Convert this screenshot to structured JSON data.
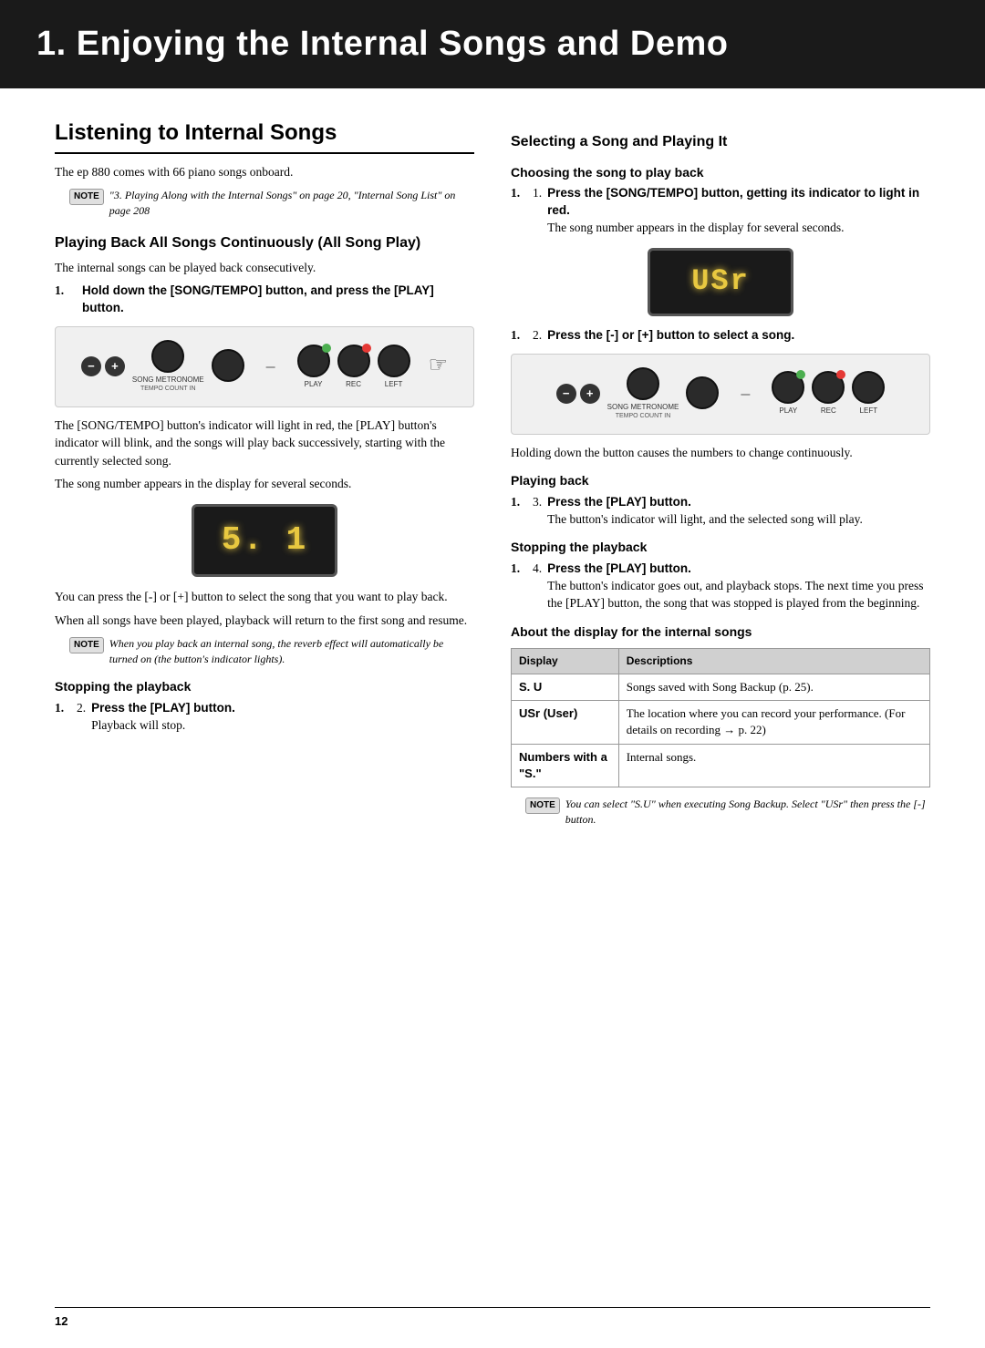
{
  "chapter": {
    "title": "1. Enjoying the Internal Songs and Demo"
  },
  "notes": {
    "label": "NOTE"
  },
  "sections": {
    "listening": {
      "title": "Listening to Internal Songs",
      "intro": "The ep 880 comes with 66 piano songs onboard.",
      "note": "\"3. Playing Along with the Internal Songs\" on page 20, \"Internal Song List\" on page 208"
    },
    "allSongPlay": {
      "title": "Playing Back All Songs Continuously (All Song Play)",
      "intro": "The internal songs can be played back consecutively.",
      "step1": "Hold down the [SONG/TEMPO] button, and press the [PLAY] button.",
      "desc1": "The [SONG/TEMPO] button's indicator will light in red, the [PLAY] button's indicator will blink, and the songs will play back successively, starting with the currently selected song.",
      "desc2": "The song number appears in the display for several seconds.",
      "selectSong": "You can press the [-] or [+] button to select the song that you want to play back.",
      "allSongsPlayed": "When all songs have been played, playback will return to the first song and resume.",
      "note": "When you play back an internal song, the reverb effect will automatically be turned on (the button's indicator lights)."
    },
    "stoppingLeft": {
      "title": "Stopping the playback",
      "step2": "Press the [PLAY] button.",
      "step2desc": "Playback will stop."
    },
    "selectingSong": {
      "title": "Selecting a Song and Playing It",
      "subtitle": "Choosing the song to play back",
      "step1": "Press the [SONG/TEMPO] button, getting its indicator to light in red.",
      "step1desc": "The song number appears in the display for several seconds.",
      "step2": "Press the [-] or [+] button to select a song.",
      "holdingDesc": "Holding down the button causes the numbers to change continuously."
    },
    "playingBack": {
      "title": "Playing back",
      "step3": "Press the [PLAY] button.",
      "step3desc": "The button's indicator will light, and the selected song will play."
    },
    "stoppingRight": {
      "title": "Stopping the playback",
      "step4": "Press the [PLAY] button.",
      "step4desc": "The button's indicator goes out, and playback stops. The next time you press the [PLAY] button, the song that was stopped is played from the beginning."
    },
    "displayInternal": {
      "title": "About the display for the internal songs",
      "note": "You can select \"S.U\" when executing Song Backup. Select \"USr\" then press the [-] button."
    }
  },
  "controls": {
    "songLabel": "SONG METRONOME",
    "countIn": "TEMPO  COUNT IN",
    "metronomeLabel": "",
    "playLabel": "PLAY",
    "recLabel": "REC",
    "leftLabel": "LEFT"
  },
  "displays": {
    "lcd1": "5. 1",
    "lcdusr": "USr"
  },
  "table": {
    "col1": "Display",
    "col2": "Descriptions",
    "rows": [
      {
        "display": "S. U",
        "description": "Songs saved with Song Backup (p. 25)."
      },
      {
        "display": "USr (User)",
        "description": "The location where you can record your performance. (For details on recording → p. 22)"
      },
      {
        "display": "Numbers with a \"S.\"",
        "description": "Internal songs."
      }
    ]
  },
  "footer": {
    "pageNumber": "12"
  }
}
